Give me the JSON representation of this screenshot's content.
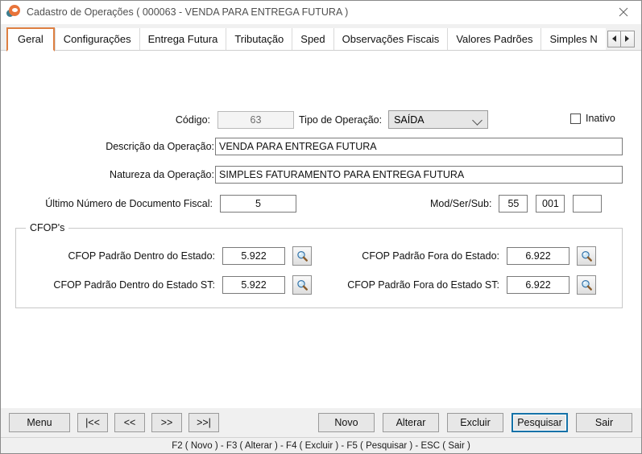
{
  "window": {
    "title": "Cadastro de Operações ( 000063 - VENDA PARA ENTREGA FUTURA )",
    "app_icon": "app-logo-icon",
    "close_icon": "close-icon"
  },
  "tabs": {
    "items": [
      {
        "label": "Geral",
        "active": true
      },
      {
        "label": "Configurações",
        "active": false
      },
      {
        "label": "Entrega Futura",
        "active": false
      },
      {
        "label": "Tributação",
        "active": false
      },
      {
        "label": "Sped",
        "active": false
      },
      {
        "label": "Observações Fiscais",
        "active": false
      },
      {
        "label": "Valores Padrões",
        "active": false
      },
      {
        "label": "Simples N",
        "active": false
      }
    ],
    "scroll_left_icon": "triangle-left-icon",
    "scroll_right_icon": "triangle-right-icon"
  },
  "form": {
    "codigo_label": "Código:",
    "codigo_value": "63",
    "tipo_operacao_label": "Tipo de Operação:",
    "tipo_operacao_value": "SAÍDA",
    "inativo_label": "Inativo",
    "inativo_checked": false,
    "descricao_label": "Descrição da Operação:",
    "descricao_value": "VENDA PARA ENTREGA FUTURA",
    "natureza_label": "Natureza da Operação:",
    "natureza_value": "SIMPLES FATURAMENTO PARA ENTREGA FUTURA",
    "ultimo_numero_label": "Último Número de Documento Fiscal:",
    "ultimo_numero_value": "5",
    "modsersub_label": "Mod/Ser/Sub:",
    "mod_value": "55",
    "ser_value": "001",
    "sub_value": ""
  },
  "cfop": {
    "group_title": "CFOP's",
    "dentro_label": "CFOP Padrão Dentro do Estado:",
    "dentro_value": "5.922",
    "fora_label": "CFOP Padrão Fora do Estado:",
    "fora_value": "6.922",
    "dentro_st_label": "CFOP Padrão Dentro do Estado ST:",
    "dentro_st_value": "5.922",
    "fora_st_label": "CFOP Padrão Fora do Estado ST:",
    "fora_st_value": "6.922",
    "search_icon": "magnifier-icon"
  },
  "toolbar": {
    "menu_label": "Menu",
    "first_label": "|<<",
    "prev_label": "<<",
    "next_label": ">>",
    "last_label": ">>|",
    "novo_label": "Novo",
    "alterar_label": "Alterar",
    "excluir_label": "Excluir",
    "pesquisar_label": "Pesquisar",
    "sair_label": "Sair"
  },
  "statusbar": {
    "hints": "F2 ( Novo )  -  F3 ( Alterar )  -  F4 ( Excluir )  -  F5 ( Pesquisar )  -  ESC ( Sair )"
  },
  "colors": {
    "accent_tab": "#dd7f41",
    "focus_border": "#1572a8",
    "window_bg": "#f0f0f0"
  }
}
